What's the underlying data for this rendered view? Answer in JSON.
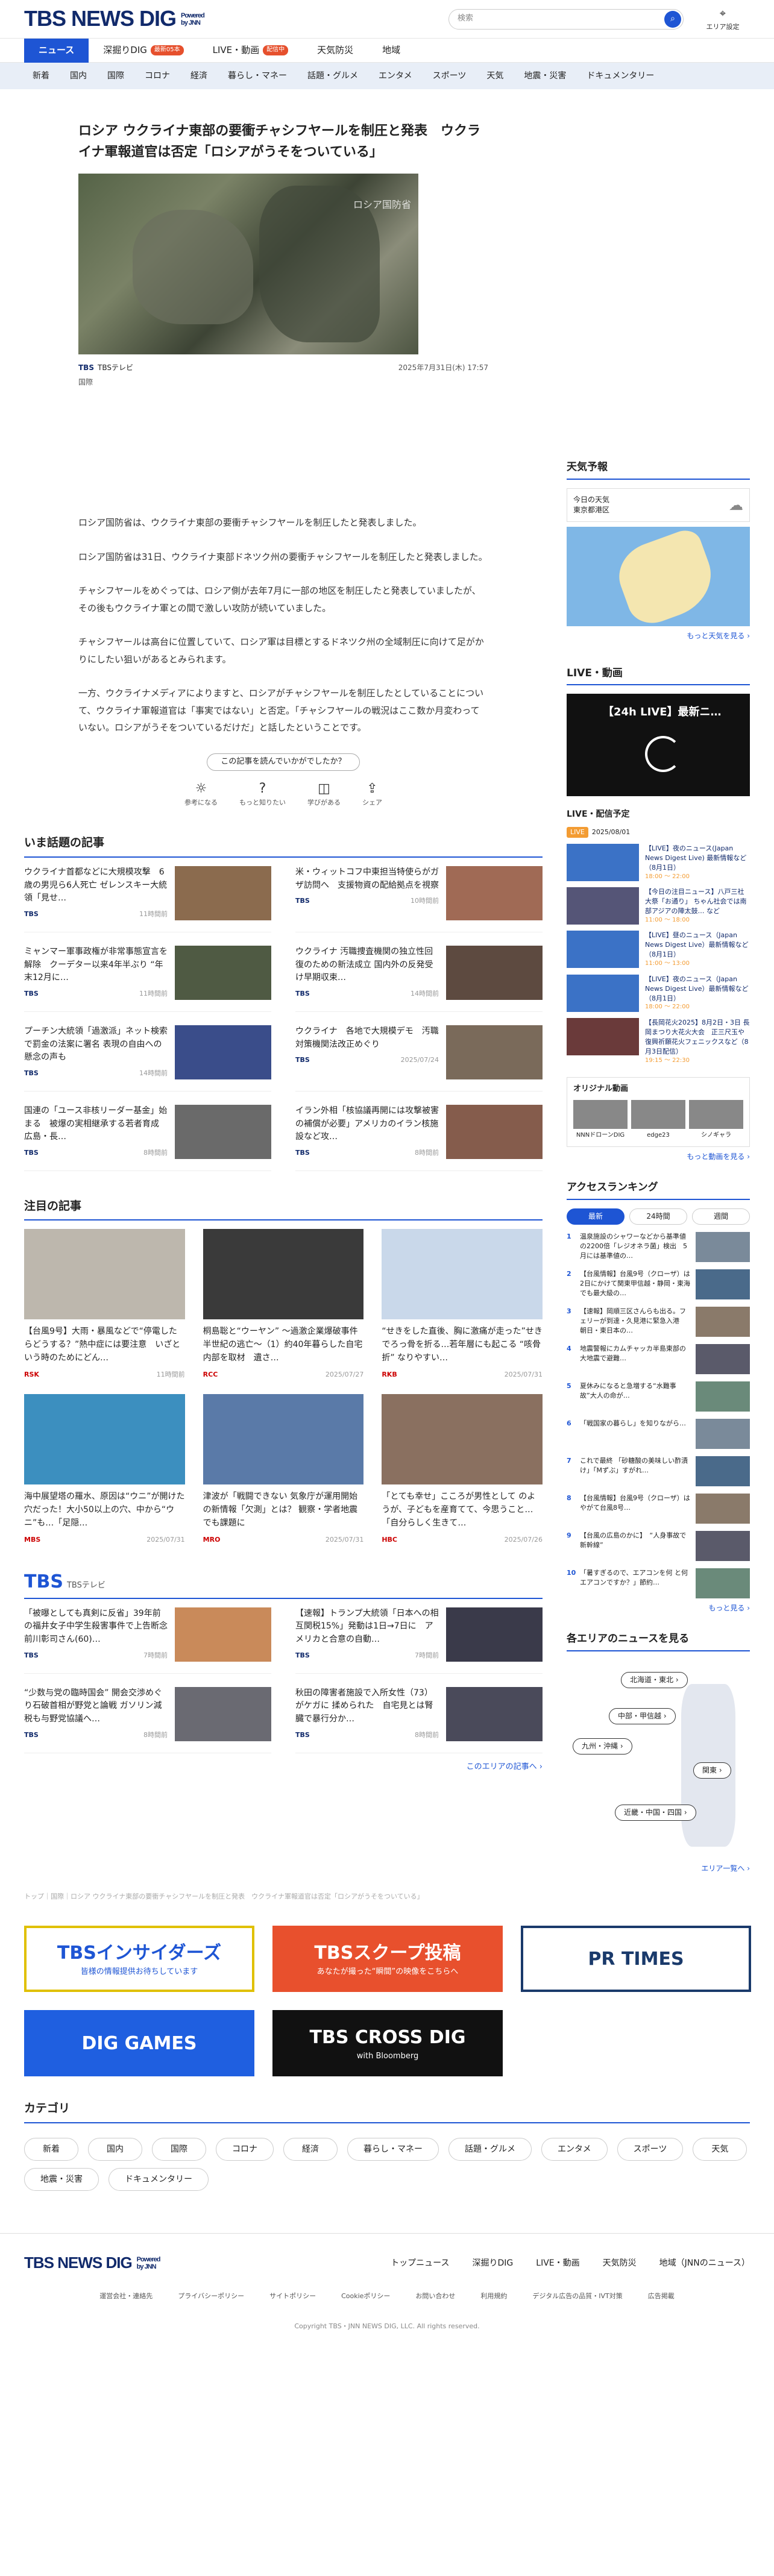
{
  "header": {
    "logo": "TBS NEWS DIG",
    "logo_sub1": "Powered",
    "logo_sub2": "by JNN",
    "search_placeholder": "検索",
    "area_label": "エリア設定"
  },
  "topnav": [
    {
      "label": "ニュース",
      "badge": ""
    },
    {
      "label": "深掘りDIG",
      "badge": "最新05本"
    },
    {
      "label": "LIVE・動画",
      "badge": "配信中"
    },
    {
      "label": "天気防災",
      "badge": ""
    },
    {
      "label": "地域",
      "badge": ""
    }
  ],
  "catnav": [
    "新着",
    "国内",
    "国際",
    "コロナ",
    "経済",
    "暮らし・マネー",
    "話題・グルメ",
    "エンタメ",
    "スポーツ",
    "天気",
    "地震・災害",
    "ドキュメンタリー"
  ],
  "article": {
    "title": "ロシア ウクライナ東部の要衝チャシフヤールを制圧と発表　ウクライナ軍報道官は否定「ロシアがうそをついている」",
    "image_watermark": "ロシア国防省",
    "source_logo": "TBS",
    "source": "TBSテレビ",
    "date": "2025年7月31日(木) 17:57",
    "genre": "国際",
    "paragraphs": [
      "ロシア国防省は、ウクライナ東部の要衝チャシフヤールを制圧したと発表しました。",
      "ロシア国防省は31日、ウクライナ東部ドネツク州の要衝チャシフヤールを制圧したと発表しました。",
      "チャシフヤールをめぐっては、ロシア側が去年7月に一部の地区を制圧したと発表していましたが、その後もウクライナ軍との間で激しい攻防が続いていました。",
      "チャシフヤールは高台に位置していて、ロシア軍は目標とするドネツク州の全域制圧に向けて足がかりにしたい狙いがあるとみられます。",
      "一方、ウクライナメディアによりますと、ロシアがチャシフヤールを制圧したとしていることについて、ウクライナ軍報道官は「事実ではない」と否定。「チャシフヤールの戦況はここ数か月変わっていない。ロシアがうそをついているだけだ」と話したということです。"
    ],
    "feedback_q": "この記事を読んでいかがでしたか？",
    "feedback_btns": [
      {
        "icon": "lightbulb-icon",
        "glyph": "☼",
        "label": "参考になる"
      },
      {
        "icon": "question-icon",
        "glyph": "?",
        "label": "もっと知りたい"
      },
      {
        "icon": "book-icon",
        "glyph": "◫",
        "label": "学びがある"
      },
      {
        "icon": "share-icon",
        "glyph": "⇪",
        "label": "シェア"
      }
    ]
  },
  "trending": {
    "title": "いま話題の記事",
    "items": [
      {
        "text": "ウクライナ首都などに大規模攻撃　6歳の男児ら6人死亡 ゼレンスキー大統領「見せ…",
        "src": "TBS",
        "date": "11時間前",
        "color": "#8b6b4e"
      },
      {
        "text": "米・ウィットコフ中東担当特使らがガザ訪問へ　支援物資の配給拠点を視察",
        "src": "TBS",
        "date": "10時間前",
        "color": "#a06a55"
      },
      {
        "text": "ミャンマー軍事政権が非常事態宣言を解除　クーデター以来4年半ぶり “年末12月に…",
        "src": "TBS",
        "date": "11時間前",
        "color": "#4f5a43"
      },
      {
        "text": "ウクライナ 汚職捜査機関の独立性回復のための新法成立 国内外の反発受け早期収束…",
        "src": "TBS",
        "date": "14時間前",
        "color": "#5d4a40"
      },
      {
        "text": "プーチン大統領「過激派」ネット検索で罰金の法案に署名 表現の自由への懸念の声も",
        "src": "TBS",
        "date": "14時間前",
        "color": "#3a4d8a"
      },
      {
        "text": "ウクライナ　各地で大規模デモ　汚職対策機関法改正めぐり",
        "src": "TBS",
        "date": "2025/07/24",
        "color": "#7a6a5a"
      },
      {
        "text": "国連の「ユース非核リーダー基金」始まる　被爆の実相継承する若者育成　広島・長…",
        "src": "TBS",
        "date": "8時間前",
        "color": "#6a6a6a"
      },
      {
        "text": "イラン外相「核協議再開には攻撃被害の補償が必要」アメリカのイラン核施設など攻…",
        "src": "TBS",
        "date": "8時間前",
        "color": "#855c4c"
      }
    ]
  },
  "featured": {
    "title": "注目の記事",
    "items": [
      {
        "text": "【台風9号】大雨・暴風などで“停電したらどうする？”熱中症には要注意　いざという時のためにどん…",
        "src": "RSK",
        "date": "11時間前",
        "color": "#bdb7ad"
      },
      {
        "text": "桐島聡と“ウーヤン” ～過激企業爆破事件 半世紀の逃亡～（1）約40年暮らした自宅内部を取材　遺さ…",
        "src": "RCC",
        "date": "2025/07/27",
        "color": "#3a3a3a"
      },
      {
        "text": "“せきをした直後、胸に激痛が走った”せきでろっ骨を折る…若年層にも起こる “咳骨折” なりやすい…",
        "src": "RKB",
        "date": "2025/07/31",
        "color": "#c9d8ea"
      },
      {
        "text": "海中展望塔の羅水、原因は“ウニ”が開けた穴だった！大小50以上の穴、中から“ウニ”も…「足隠…",
        "src": "MBS",
        "date": "2025/07/31",
        "color": "#3c8fbf"
      },
      {
        "text": "津波が「戦闘できない 気象庁が運用開始の新情報「欠測」とは？ 観察・学者地震でも課題に",
        "src": "MRO",
        "date": "2025/07/31",
        "color": "#5a7aa8"
      },
      {
        "text": "「とても幸せ」こころが男性として のようが、子どもを産育てて、今思うこと…「自分らしく生きて…",
        "src": "HBC",
        "date": "2025/07/26",
        "color": "#8a7060"
      }
    ]
  },
  "tbs_section": {
    "title": "TBS",
    "subtitle": "TBSテレビ",
    "items": [
      {
        "text": "「被曝としても真剣に反省」39年前の福井女子中学生殺害事件で上告断念 前川彰司さん(60)…",
        "date": "7時間前",
        "color": "#c98a5a"
      },
      {
        "text": "【速報】トランプ大統領「日本への相互関税15%」発動は1日→7日に　アメリカと合意の自動…",
        "date": "7時間前",
        "color": "#3a3a4a"
      },
      {
        "text": "“少数与党の臨時国会” 開会交渉めぐり石破首相が野党と論戦 ガソリン減税も与野党協議へ…",
        "date": "8時間前",
        "color": "#6a6a72"
      },
      {
        "text": "秋田の障害者施設で入所女性（73）がケガに 揉められた　自宅見とは腎臓で暴行分か…",
        "date": "8時間前",
        "color": "#4a4a5a"
      }
    ],
    "more": "このエリアの記事へ ›"
  },
  "breadcrumb": "トップ｜国際｜ロシア ウクライナ東部の要衝チャシフヤールを制圧と発表　ウクライナ軍報道官は否定「ロシアがうそをついている」",
  "banners": [
    {
      "label": "TBSインサイダーズ",
      "sub": "皆様の情報提供お待ちしています",
      "bg": "#ffffff",
      "fg": "#1e55d4",
      "border": "#e0c000"
    },
    {
      "label": "TBSスクープ投稿",
      "sub": "あなたが撮った“瞬間”の映像をこちらへ",
      "bg": "#e8502d",
      "fg": "#ffffff",
      "border": "#e8502d"
    },
    {
      "label": "PR TIMES",
      "sub": "",
      "bg": "#ffffff",
      "fg": "#1a3a6b",
      "border": "#1a3a6b"
    },
    {
      "label": "DIG GAMES",
      "sub": "",
      "bg": "#1f5fe0",
      "fg": "#ffffff",
      "border": "#1f5fe0"
    },
    {
      "label": "TBS CROSS DIG",
      "sub": "with Bloomberg",
      "bg": "#111111",
      "fg": "#ffffff",
      "border": "#111111"
    }
  ],
  "categories": {
    "title": "カテゴリ",
    "items": [
      "新着",
      "国内",
      "国際",
      "コロナ",
      "経済",
      "暮らし・マネー",
      "話題・グルメ",
      "エンタメ",
      "スポーツ",
      "天気",
      "地震・災害",
      "ドキュメンタリー"
    ]
  },
  "footer": {
    "links": [
      "トップニュース",
      "深掘りDIG",
      "LIVE・動画",
      "天気防災",
      "地域（JNNのニュース）"
    ],
    "sub_links": [
      "運営会社・連絡先",
      "プライバシーポリシー",
      "サイトポリシー",
      "Cookieポリシー",
      "お問い合わせ",
      "利用規約",
      "デジタル広告の品質・IVT対策",
      "広告掲載"
    ],
    "copyright": "Copyright TBS・JNN NEWS DIG, LLC. All rights reserved."
  },
  "sidebar": {
    "weather": {
      "title": "天気予報",
      "today": "今日の天気",
      "region": "東京都港区",
      "more": "もっと天気を見る ›"
    },
    "live": {
      "title": "LIVE・動画",
      "player_label": "【24h LIVE】最新ニ…",
      "sched_title": "LIVE・配信予定",
      "day1": "2025/08/01",
      "day1_tag": "LIVE"
    },
    "schedule": [
      {
        "text": "【LIVE】夜のニュース(Japan News Digest Live) 最新情報など（8月1日）",
        "time": "18:00 〜 22:00",
        "color": "#3b72c6"
      },
      {
        "text": "【今日の注目ニュース】八戸三社大祭「お通り」 ちゃん社会では南部アジアの陣太鼓… など",
        "time": "11:00 〜 18:00",
        "color": "#557"
      },
      {
        "text": "【LIVE】昼のニュース（Japan News Digest Live）最新情報など（8月1日）",
        "time": "11:00 〜 13:00",
        "color": "#3b72c6"
      },
      {
        "text": "【LIVE】夜のニュース（Japan News Digest Live）最新情報など（8月1日）",
        "time": "18:00 〜 22:00",
        "color": "#3b72c6"
      },
      {
        "text": "【長岡花火2025】8月2日・3日 長岡まつり大花火大会　正三尺玉や復興祈願花火フェニックスなど（8月3日配信）",
        "time": "19:15 〜 22:30",
        "color": "#6a3a3a"
      }
    ],
    "original": {
      "title": "オリジナル動画",
      "items": [
        "NNNドローンDIG",
        "edge23",
        "シノギャラ"
      ],
      "more": "もっと動画を見る ›"
    },
    "ranking": {
      "title": "アクセスランキング",
      "tabs": [
        "最新",
        "24時間",
        "週間"
      ],
      "items": [
        "温泉施設のシャワーなどから基準値の2200倍「レジオネラ菌」検出　5月には基準値の…",
        "【台風情報】台風9号（クローザ）は2日にかけて関東甲信越・静岡・東海でも最大級の…",
        "【速報】岡順三区さんらも出る。フェリーが到達・久見港に緊急入港　朝日・東日本の…",
        "地震警報にカムチャッカ半島東部の大地震で避難…",
        "夏休みになると急増する“水難事故”大人の命が…",
        "「戦国家の暮らし」を知りながら…",
        "これで最終 「砂糖酸の美味しい酢漬け」「Mずぶ」すがれ…",
        "【台風情報】台風9号（クローザ）はやがて台風8号…",
        "【台風の広島のかに】　“人身事故で新幹線”",
        "「暑すぎるので、エアコンを何 と何 エアコンですか？」節約…"
      ],
      "more": "もっと見る ›"
    },
    "area": {
      "title": "各エリアのニュースを見る",
      "areas": [
        "北海道・東北 ›",
        "中部・甲信越 ›",
        "九州・沖縄 ›",
        "関東 ›",
        "近畿・中国・四国 ›"
      ],
      "more": "エリア一覧へ ›"
    }
  },
  "colors": {
    "brand": "#112a6b",
    "accent": "#1e55d4",
    "live": "#e6502d"
  }
}
